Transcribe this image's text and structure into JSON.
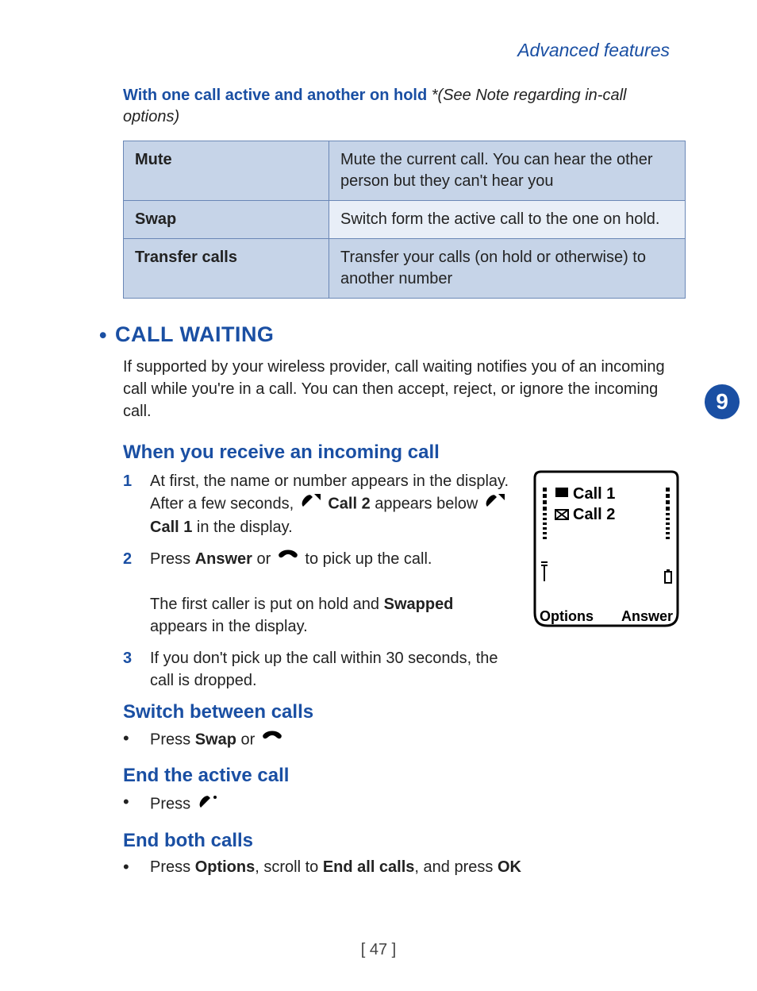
{
  "section_header": "Advanced features",
  "intro": {
    "bold": "With one call active and another on hold",
    "italic": "*(See Note regarding in-call options)"
  },
  "table": [
    {
      "key": "Mute",
      "val": "Mute the current call. You can hear the other person but they can't hear you"
    },
    {
      "key": "Swap",
      "val": "Switch form the active call to the one on hold."
    },
    {
      "key": "Transfer calls",
      "val": "Transfer your calls (on hold or otherwise) to another number"
    }
  ],
  "chapter_number": "9",
  "h2_call_waiting": "CALL WAITING",
  "call_waiting_body": "If supported by your wireless provider, call waiting notifies you of an incoming call while you're in a call. You can then accept, reject, or ignore the incoming call.",
  "h3_receive": "When you receive an incoming call",
  "steps_receive": {
    "s1a": "At first, the name or number appears in the display. After a few seconds, ",
    "s1_call2": "Call 2",
    "s1b": " appears below ",
    "s1_call1": "Call 1",
    "s1c": " in the display.",
    "s2a": "Press ",
    "s2_answer": "Answer",
    "s2b": " or ",
    "s2c": " to pick up the call.",
    "s2d": "The first caller is put on hold and ",
    "s2_swapped": "Swapped",
    "s2e": " appears in the display.",
    "s3": "If you don't pick up the call within 30 seconds, the call is dropped."
  },
  "h3_switch": "Switch between calls",
  "switch_item": {
    "a": "Press ",
    "swap": "Swap",
    "b": " or "
  },
  "h3_end_active": "End the active call",
  "end_active_item": "Press ",
  "h3_end_both": "End both calls",
  "end_both_item": {
    "a": "Press ",
    "options": "Options",
    "b": ", scroll to ",
    "endall": "End all calls",
    "c": ", and press ",
    "ok": "OK"
  },
  "figure": {
    "call1": "Call 1",
    "call2": "Call 2",
    "soft_left": "Options",
    "soft_right": "Answer"
  },
  "page_number": "[ 47 ]"
}
